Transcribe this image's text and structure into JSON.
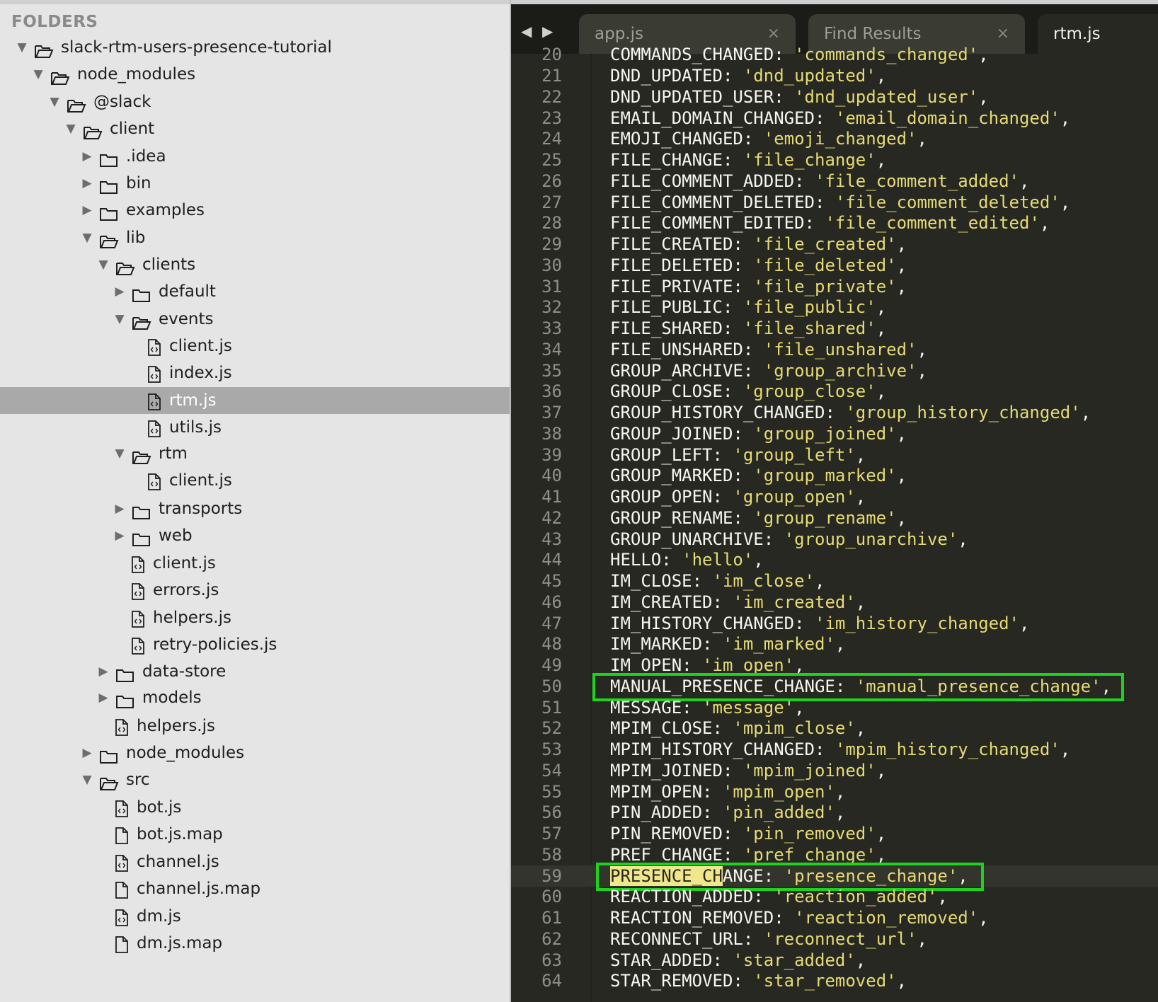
{
  "sidebar": {
    "header": "FOLDERS",
    "items": [
      {
        "label": "slack-rtm-users-presence-tutorial",
        "type": "folder",
        "open": true,
        "depth": 0
      },
      {
        "label": "node_modules",
        "type": "folder",
        "open": true,
        "depth": 1
      },
      {
        "label": "@slack",
        "type": "folder",
        "open": true,
        "depth": 2
      },
      {
        "label": "client",
        "type": "folder",
        "open": true,
        "depth": 3
      },
      {
        "label": ".idea",
        "type": "folder",
        "open": false,
        "depth": 4
      },
      {
        "label": "bin",
        "type": "folder",
        "open": false,
        "depth": 4
      },
      {
        "label": "examples",
        "type": "folder",
        "open": false,
        "depth": 4
      },
      {
        "label": "lib",
        "type": "folder",
        "open": true,
        "depth": 4
      },
      {
        "label": "clients",
        "type": "folder",
        "open": true,
        "depth": 5
      },
      {
        "label": "default",
        "type": "folder",
        "open": false,
        "depth": 6
      },
      {
        "label": "events",
        "type": "folder",
        "open": true,
        "depth": 6
      },
      {
        "label": "client.js",
        "type": "file",
        "depth": 7
      },
      {
        "label": "index.js",
        "type": "file",
        "depth": 7
      },
      {
        "label": "rtm.js",
        "type": "file",
        "depth": 7,
        "selected": true
      },
      {
        "label": "utils.js",
        "type": "file",
        "depth": 7
      },
      {
        "label": "rtm",
        "type": "folder",
        "open": true,
        "depth": 6
      },
      {
        "label": "client.js",
        "type": "file",
        "depth": 7
      },
      {
        "label": "transports",
        "type": "folder",
        "open": false,
        "depth": 6
      },
      {
        "label": "web",
        "type": "folder",
        "open": false,
        "depth": 6
      },
      {
        "label": "client.js",
        "type": "file",
        "depth": 6
      },
      {
        "label": "errors.js",
        "type": "file",
        "depth": 6
      },
      {
        "label": "helpers.js",
        "type": "file",
        "depth": 6
      },
      {
        "label": "retry-policies.js",
        "type": "file",
        "depth": 6
      },
      {
        "label": "data-store",
        "type": "folder",
        "open": false,
        "depth": 5
      },
      {
        "label": "models",
        "type": "folder",
        "open": false,
        "depth": 5
      },
      {
        "label": "helpers.js",
        "type": "file",
        "depth": 5
      },
      {
        "label": "node_modules",
        "type": "folder",
        "open": false,
        "depth": 4
      },
      {
        "label": "src",
        "type": "folder",
        "open": true,
        "depth": 4
      },
      {
        "label": "bot.js",
        "type": "file",
        "depth": 5
      },
      {
        "label": "bot.js.map",
        "type": "file",
        "depth": 5,
        "plain": true
      },
      {
        "label": "channel.js",
        "type": "file",
        "depth": 5
      },
      {
        "label": "channel.js.map",
        "type": "file",
        "depth": 5,
        "plain": true
      },
      {
        "label": "dm.js",
        "type": "file",
        "depth": 5
      },
      {
        "label": "dm.js.map",
        "type": "file",
        "depth": 5,
        "plain": true
      }
    ]
  },
  "editor": {
    "nav_back": "◀",
    "nav_forward": "▶",
    "tabs": [
      {
        "label": "app.js",
        "close": "×",
        "active": false
      },
      {
        "label": "Find Results",
        "close": "×",
        "active": false
      },
      {
        "label": "rtm.js",
        "close": "",
        "active": true
      }
    ],
    "top_partial_line": {
      "num": "20",
      "key": "COMMANDS_CHANGED",
      "value": "'commands_changed'"
    },
    "lines": [
      {
        "num": "21",
        "key": "DND_UPDATED",
        "value": "'dnd_updated'"
      },
      {
        "num": "22",
        "key": "DND_UPDATED_USER",
        "value": "'dnd_updated_user'"
      },
      {
        "num": "23",
        "key": "EMAIL_DOMAIN_CHANGED",
        "value": "'email_domain_changed'"
      },
      {
        "num": "24",
        "key": "EMOJI_CHANGED",
        "value": "'emoji_changed'"
      },
      {
        "num": "25",
        "key": "FILE_CHANGE",
        "value": "'file_change'"
      },
      {
        "num": "26",
        "key": "FILE_COMMENT_ADDED",
        "value": "'file_comment_added'"
      },
      {
        "num": "27",
        "key": "FILE_COMMENT_DELETED",
        "value": "'file_comment_deleted'"
      },
      {
        "num": "28",
        "key": "FILE_COMMENT_EDITED",
        "value": "'file_comment_edited'"
      },
      {
        "num": "29",
        "key": "FILE_CREATED",
        "value": "'file_created'"
      },
      {
        "num": "30",
        "key": "FILE_DELETED",
        "value": "'file_deleted'"
      },
      {
        "num": "31",
        "key": "FILE_PRIVATE",
        "value": "'file_private'"
      },
      {
        "num": "32",
        "key": "FILE_PUBLIC",
        "value": "'file_public'"
      },
      {
        "num": "33",
        "key": "FILE_SHARED",
        "value": "'file_shared'"
      },
      {
        "num": "34",
        "key": "FILE_UNSHARED",
        "value": "'file_unshared'"
      },
      {
        "num": "35",
        "key": "GROUP_ARCHIVE",
        "value": "'group_archive'"
      },
      {
        "num": "36",
        "key": "GROUP_CLOSE",
        "value": "'group_close'"
      },
      {
        "num": "37",
        "key": "GROUP_HISTORY_CHANGED",
        "value": "'group_history_changed'"
      },
      {
        "num": "38",
        "key": "GROUP_JOINED",
        "value": "'group_joined'"
      },
      {
        "num": "39",
        "key": "GROUP_LEFT",
        "value": "'group_left'"
      },
      {
        "num": "40",
        "key": "GROUP_MARKED",
        "value": "'group_marked'"
      },
      {
        "num": "41",
        "key": "GROUP_OPEN",
        "value": "'group_open'"
      },
      {
        "num": "42",
        "key": "GROUP_RENAME",
        "value": "'group_rename'"
      },
      {
        "num": "43",
        "key": "GROUP_UNARCHIVE",
        "value": "'group_unarchive'"
      },
      {
        "num": "44",
        "key": "HELLO",
        "value": "'hello'"
      },
      {
        "num": "45",
        "key": "IM_CLOSE",
        "value": "'im_close'"
      },
      {
        "num": "46",
        "key": "IM_CREATED",
        "value": "'im_created'"
      },
      {
        "num": "47",
        "key": "IM_HISTORY_CHANGED",
        "value": "'im_history_changed'"
      },
      {
        "num": "48",
        "key": "IM_MARKED",
        "value": "'im_marked'"
      },
      {
        "num": "49",
        "key": "IM_OPEN",
        "value": "'im_open'"
      },
      {
        "num": "50",
        "key": "MANUAL_PRESENCE_CHANGE",
        "value": "'manual_presence_change'",
        "boxed": true
      },
      {
        "num": "51",
        "key": "MESSAGE",
        "value": "'message'"
      },
      {
        "num": "52",
        "key": "MPIM_CLOSE",
        "value": "'mpim_close'"
      },
      {
        "num": "53",
        "key": "MPIM_HISTORY_CHANGED",
        "value": "'mpim_history_changed'"
      },
      {
        "num": "54",
        "key": "MPIM_JOINED",
        "value": "'mpim_joined'"
      },
      {
        "num": "55",
        "key": "MPIM_OPEN",
        "value": "'mpim_open'"
      },
      {
        "num": "56",
        "key": "PIN_ADDED",
        "value": "'pin_added'"
      },
      {
        "num": "57",
        "key": "PIN_REMOVED",
        "value": "'pin_removed'"
      },
      {
        "num": "58",
        "key": "PREF_CHANGE",
        "value": "'pref_change'"
      },
      {
        "num": "59",
        "key": "PRESENCE_CHANGE",
        "value": "'presence_change'",
        "current": true,
        "boxed": true,
        "highlight_len": 11
      },
      {
        "num": "60",
        "key": "REACTION_ADDED",
        "value": "'reaction_added'"
      },
      {
        "num": "61",
        "key": "REACTION_REMOVED",
        "value": "'reaction_removed'"
      },
      {
        "num": "62",
        "key": "RECONNECT_URL",
        "value": "'reconnect_url'"
      },
      {
        "num": "63",
        "key": "STAR_ADDED",
        "value": "'star_added'"
      },
      {
        "num": "64",
        "key": "STAR_REMOVED",
        "value": "'star_removed'"
      }
    ]
  }
}
